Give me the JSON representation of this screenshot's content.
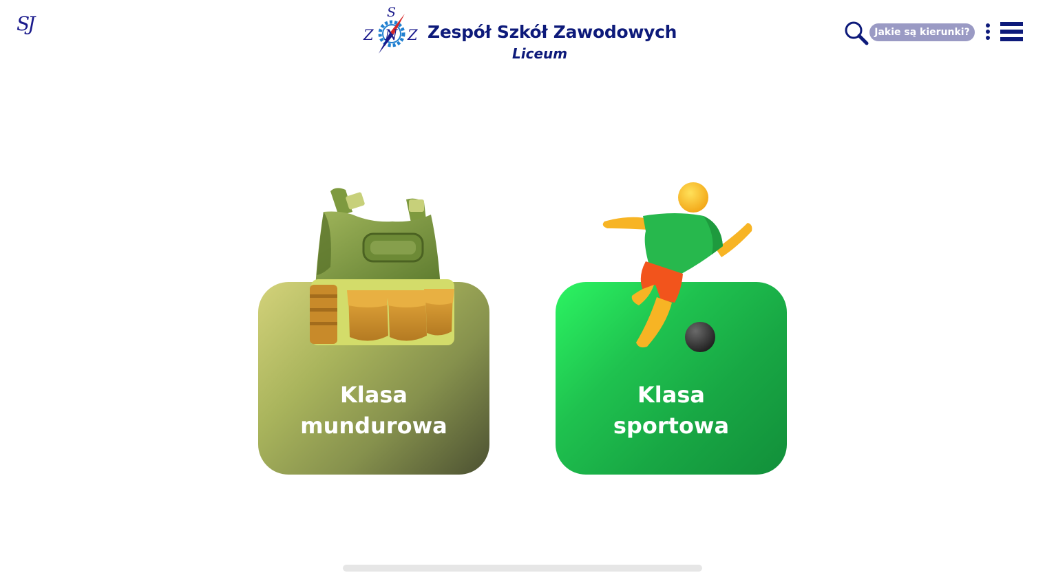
{
  "header": {
    "corner_mark": "SJ",
    "logo_letters": {
      "top": "S",
      "left": "Z",
      "middle": "N",
      "right": "Z"
    },
    "title": "Zespół Szkół Zawodowych",
    "subtitle": "Liceum",
    "question_button": "Jakie są kierunki?",
    "icons": {
      "search": "search-icon",
      "more": "kebab-menu-icon",
      "menu": "hamburger-menu-icon"
    }
  },
  "cards": [
    {
      "line1": "Klasa",
      "line2": "mundurowa",
      "illustration": "tactical-vest-icon",
      "gradient_colors": [
        "#d3d27a",
        "#4c5132"
      ]
    },
    {
      "line1": "Klasa",
      "line2": "sportowa",
      "illustration": "football-player-icon",
      "gradient_colors": [
        "#2cf462",
        "#128f3a"
      ]
    }
  ],
  "colors": {
    "brand_navy": "#0d1a7a",
    "pill_bg": "#9a9ac4",
    "scrollbar": "#e6e6e6"
  }
}
